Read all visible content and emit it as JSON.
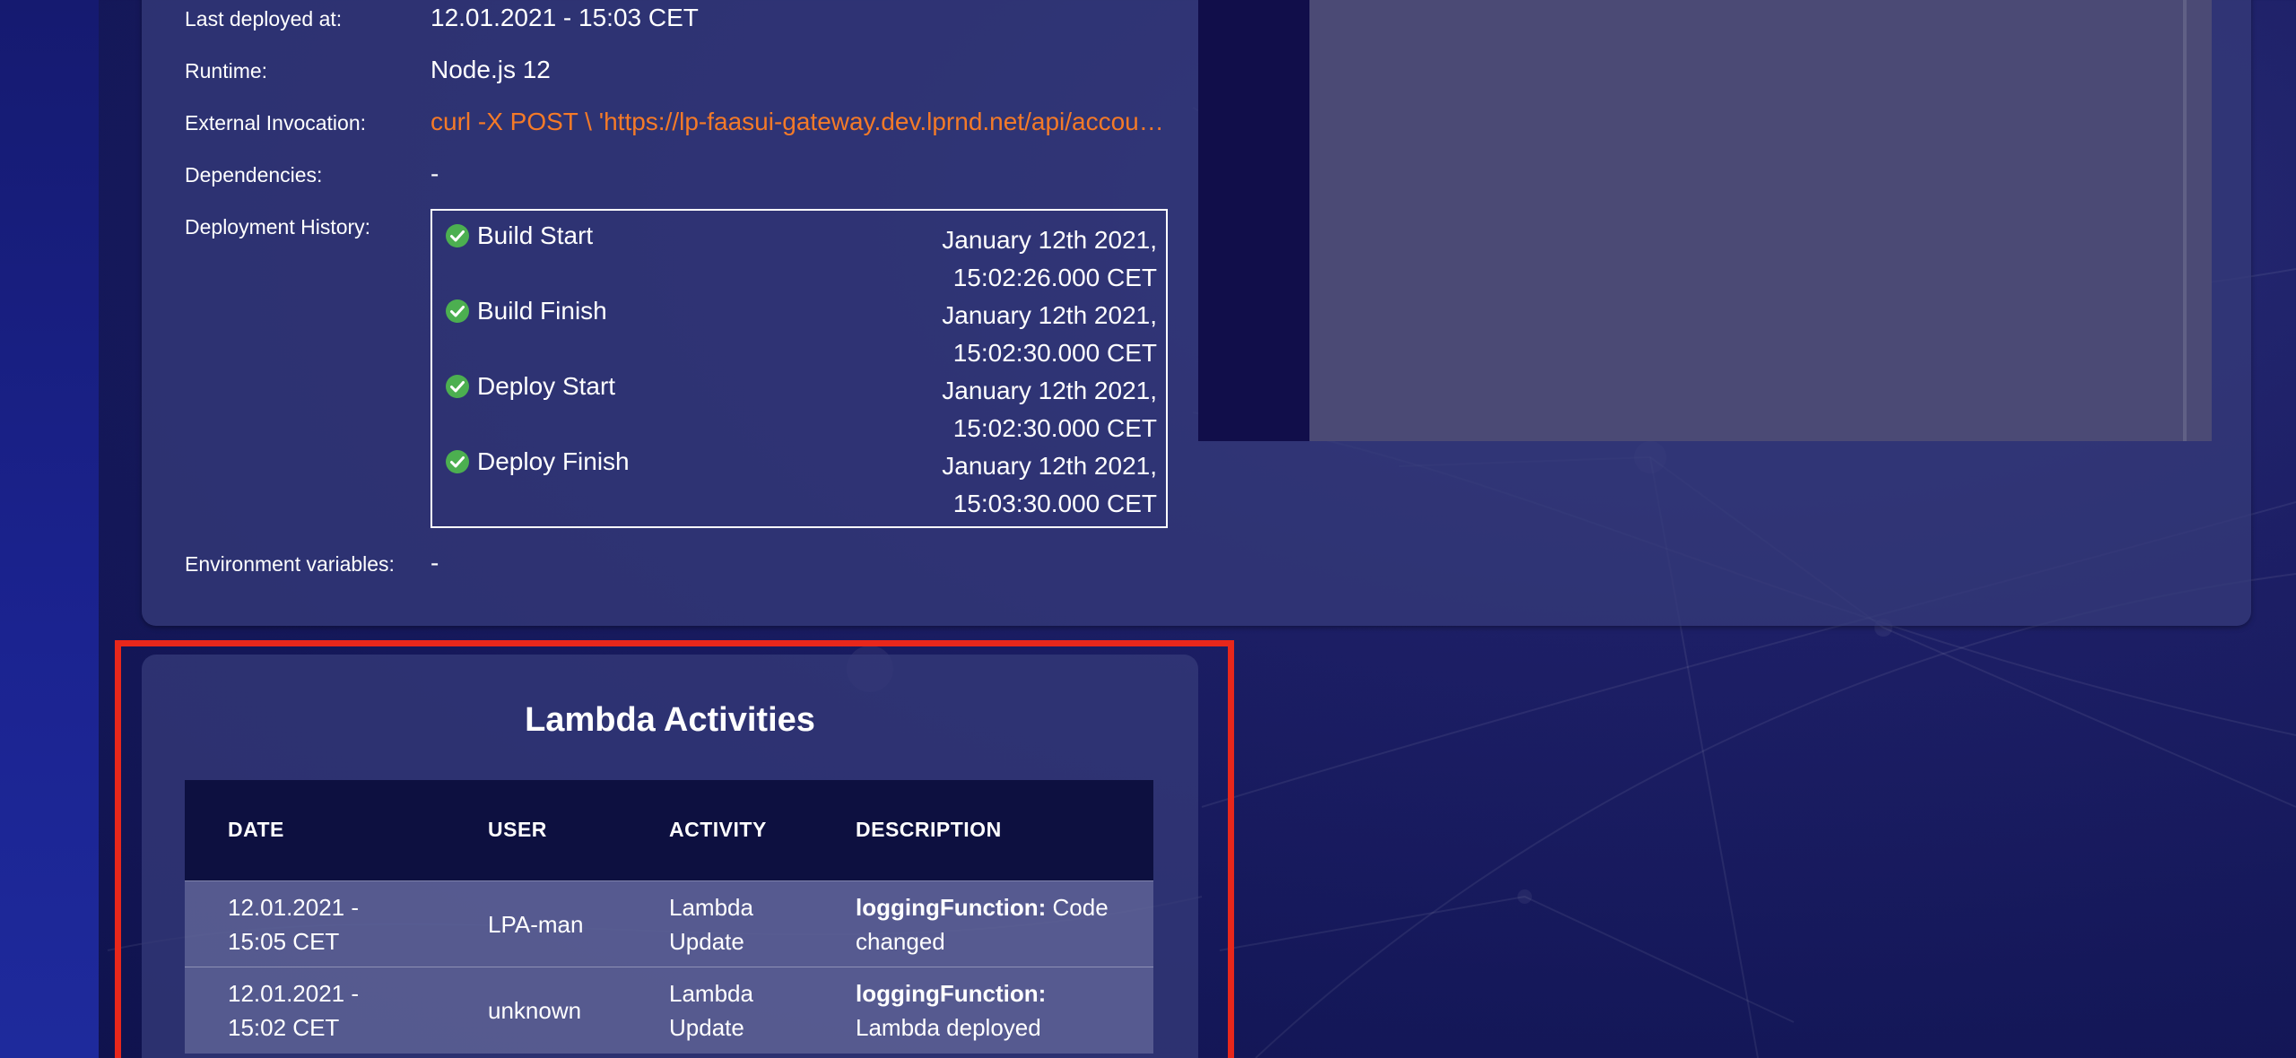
{
  "details": {
    "last_deployed": {
      "label": "Last deployed at:",
      "value": "12.01.2021 - 15:03 CET"
    },
    "runtime": {
      "label": "Runtime:",
      "value": "Node.js 12"
    },
    "external_invocation": {
      "label": "External Invocation:",
      "value": "curl -X POST \\ 'https://lp-faasui-gateway.dev.lprnd.net/api/account/..."
    },
    "dependencies": {
      "label": "Dependencies:",
      "value": "-"
    },
    "deployment_history": {
      "label": "Deployment History:"
    },
    "environment_variables": {
      "label": "Environment variables:",
      "value": "-"
    }
  },
  "history": [
    {
      "label": "Build Start",
      "time": "January 12th 2021, 15:02:26.000 CET",
      "icon": "check-circle-icon"
    },
    {
      "label": "Build Finish",
      "time": "January 12th 2021, 15:02:30.000 CET",
      "icon": "check-circle-icon"
    },
    {
      "label": "Deploy Start",
      "time": "January 12th 2021, 15:02:30.000 CET",
      "icon": "check-circle-icon"
    },
    {
      "label": "Deploy Finish",
      "time": "January 12th 2021, 15:03:30.000 CET",
      "icon": "check-circle-icon"
    }
  ],
  "activities": {
    "title": "Lambda Activities",
    "columns": [
      "DATE",
      "USER",
      "ACTIVITY",
      "DESCRIPTION"
    ],
    "rows": [
      {
        "date": "12.01.2021 - 15:05 CET",
        "user": "LPA-man",
        "activity": "Lambda Update",
        "desc_bold": "loggingFunction:",
        "desc_text": "Code changed"
      },
      {
        "date": "12.01.2021 - 15:02 CET",
        "user": "unknown",
        "activity": "Lambda Update",
        "desc_bold": "loggingFunction:",
        "desc_text": "Lambda deployed"
      }
    ]
  },
  "colors": {
    "link": "#f47a28",
    "success": "#4caf50",
    "highlight": "#e8271b"
  }
}
